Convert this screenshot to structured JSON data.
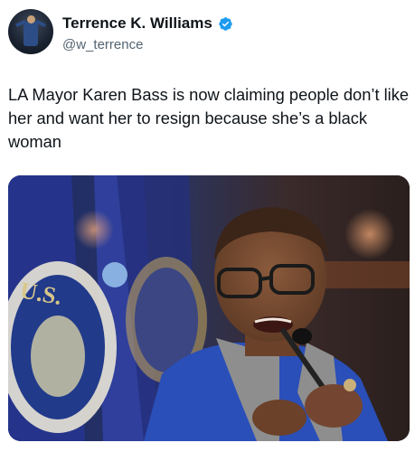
{
  "author": {
    "display_name": "Terrence K. Williams",
    "handle": "@w_terrence",
    "verified": true,
    "verified_color": "#1d9bf0"
  },
  "tweet": {
    "text": "LA Mayor Karen Bass is now claiming people don’t like her and want her to resign because she’s a black woman"
  },
  "media": {
    "type": "photo",
    "flag_text": "U.S."
  },
  "colors": {
    "text": "#0f1419",
    "secondary_text": "#536471",
    "background": "#ffffff"
  }
}
